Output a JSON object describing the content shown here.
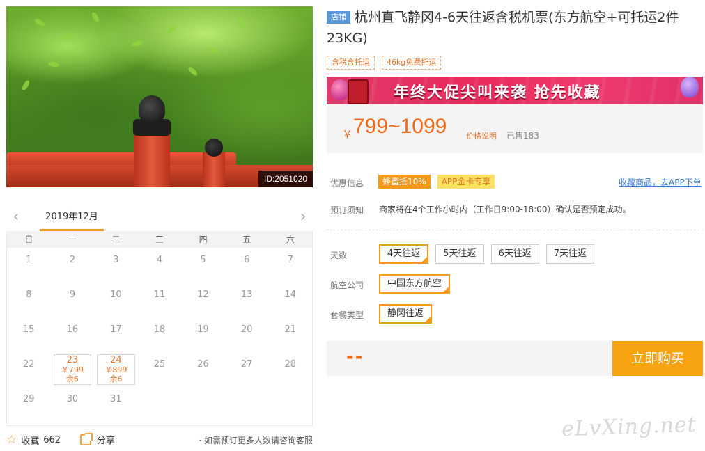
{
  "photo": {
    "id_label": "ID:2051020"
  },
  "calendar": {
    "month_label": "2019年12月",
    "prev_icon": "chevron-left-icon",
    "next_icon": "chevron-right-icon",
    "weekdays": [
      "日",
      "一",
      "二",
      "三",
      "四",
      "五",
      "六"
    ],
    "days": [
      {
        "day": "1"
      },
      {
        "day": "2"
      },
      {
        "day": "3"
      },
      {
        "day": "4"
      },
      {
        "day": "5"
      },
      {
        "day": "6"
      },
      {
        "day": "7"
      },
      {
        "day": "8"
      },
      {
        "day": "9"
      },
      {
        "day": "10"
      },
      {
        "day": "11"
      },
      {
        "day": "12"
      },
      {
        "day": "13"
      },
      {
        "day": "14"
      },
      {
        "day": "15"
      },
      {
        "day": "16"
      },
      {
        "day": "17"
      },
      {
        "day": "18"
      },
      {
        "day": "19"
      },
      {
        "day": "20"
      },
      {
        "day": "21"
      },
      {
        "day": "22"
      },
      {
        "day": "23",
        "price": "￥799",
        "stock": "余6"
      },
      {
        "day": "24",
        "price": "￥899",
        "stock": "余6"
      },
      {
        "day": "25"
      },
      {
        "day": "26"
      },
      {
        "day": "27"
      },
      {
        "day": "28"
      },
      {
        "day": "29"
      },
      {
        "day": "30"
      },
      {
        "day": "31"
      }
    ]
  },
  "footer": {
    "favorite_label": "收藏",
    "favorite_count": "662",
    "share_label": "分享",
    "consult_text": "· 如需预订更多人数请咨询客服"
  },
  "product": {
    "shop_tag": "店铺",
    "title": "杭州直飞静冈4-6天往返含税机票(东方航空+可托运2件23KG)",
    "tags": [
      "含税含托运",
      "46kg免费托运"
    ],
    "banner_text": "年终大促尖叫来袭  抢先收藏",
    "price_currency": "￥",
    "price_range": "799~1099",
    "price_note": "价格说明",
    "sold_text": "已售183"
  },
  "info": {
    "promo_label": "优惠信息",
    "promo_tags": [
      "蜂蜜抵10%",
      "APP金卡专享"
    ],
    "fav_link": "收藏商品，去APP下单",
    "notice_label": "预订须知",
    "notice_text": "商家将在4个工作小时内（工作日9:00-18:00）确认是否预定成功。"
  },
  "options": {
    "days_label": "天数",
    "days": [
      "4天往返",
      "5天往返",
      "6天往返",
      "7天往返"
    ],
    "airline_label": "航空公司",
    "airlines": [
      "中国东方航空"
    ],
    "package_label": "套餐类型",
    "packages": [
      "静冈往返"
    ]
  },
  "purchase": {
    "total": "--",
    "buy_label": "立即购买"
  },
  "watermark": "eLvXing.net",
  "colors": {
    "accent": "#f39a1e",
    "price": "#f06a1c",
    "link": "#3b7bcf",
    "shop_tag": "#5b97d8"
  }
}
